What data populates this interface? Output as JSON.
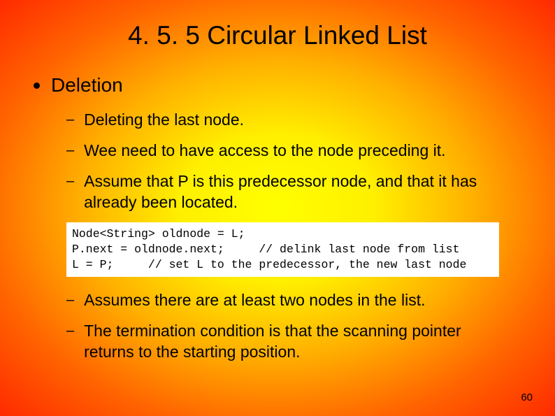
{
  "title": "4. 5. 5 Circular Linked List",
  "main_bullet": "Deletion",
  "sub_items_before": [
    "Deleting the last node.",
    "Wee need to have access to the node preceding it.",
    "Assume that P is this predecessor node, and that it has already been located."
  ],
  "code": "Node<String> oldnode = L;\nP.next = oldnode.next;     // delink last node from list\nL = P;     // set L to the predecessor, the new last node",
  "sub_items_after": [
    "Assumes there are at least two nodes in the list.",
    "The termination condition is that the scanning pointer returns to the starting position."
  ],
  "page_number": "60"
}
